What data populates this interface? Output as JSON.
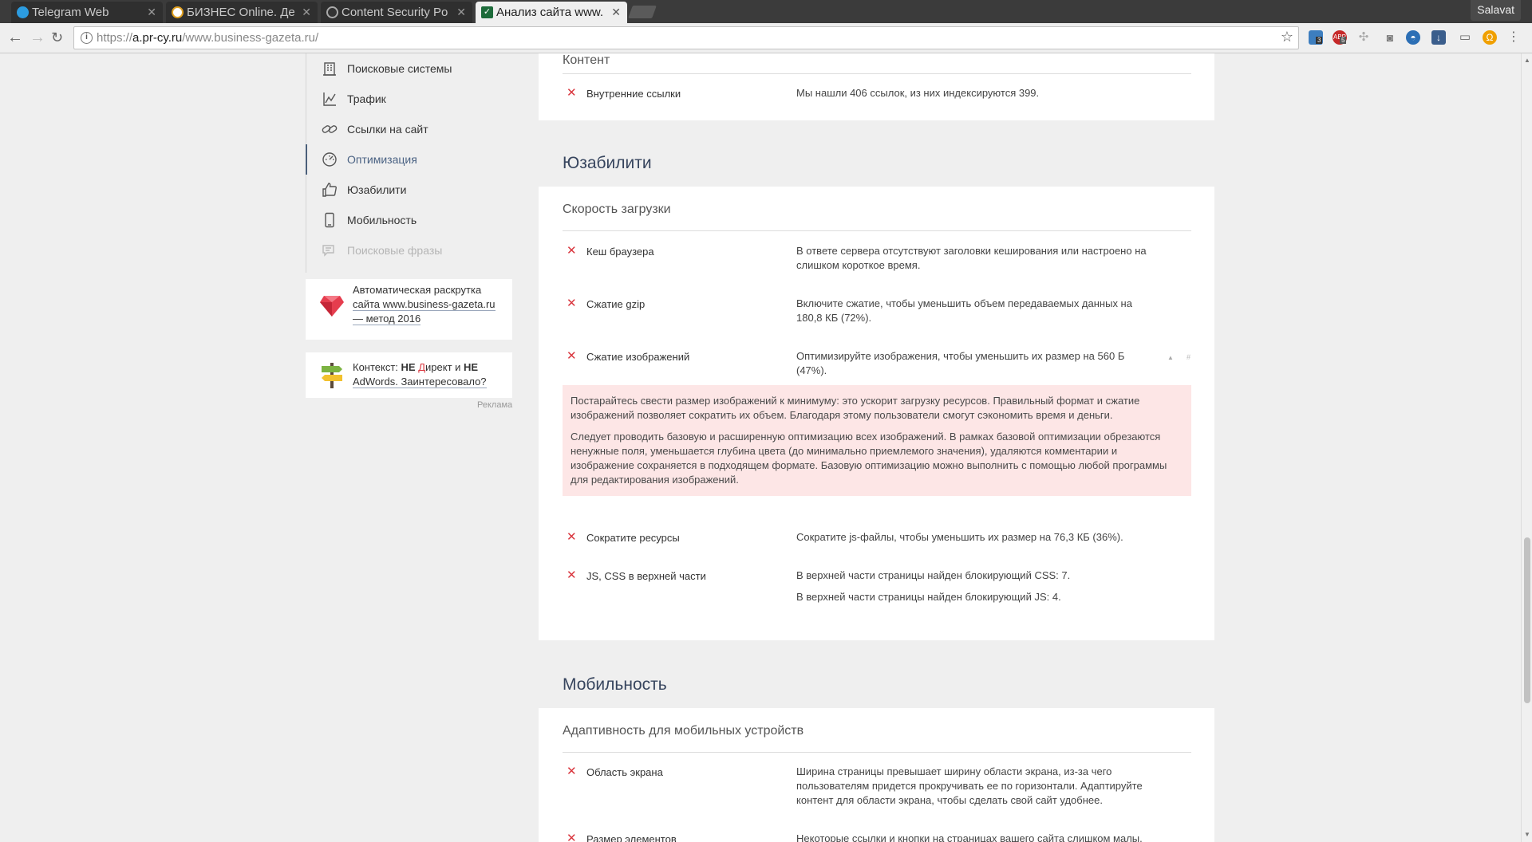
{
  "browser": {
    "tabs": [
      {
        "title": "Telegram Web",
        "active": false
      },
      {
        "title": "БИЗНЕС Online. Де",
        "active": false
      },
      {
        "title": "Content Security Po",
        "active": false
      },
      {
        "title": "Анализ сайта www.",
        "active": true
      }
    ],
    "profile": "Salavat",
    "url_prefix": "https://",
    "url_host": "a.pr-cy.ru",
    "url_path": "/www.business-gazeta.ru/",
    "ext_badges": [
      "3",
      "5"
    ]
  },
  "sidebar": {
    "items": [
      {
        "label": "Поисковые системы",
        "icon": "building-icon"
      },
      {
        "label": "Трафик",
        "icon": "chart-icon"
      },
      {
        "label": "Ссылки на сайт",
        "icon": "link-icon"
      },
      {
        "label": "Оптимизация",
        "icon": "speedometer-icon",
        "active": true
      },
      {
        "label": "Юзабилити",
        "icon": "thumbs-up-icon"
      },
      {
        "label": "Мобильность",
        "icon": "phone-icon"
      },
      {
        "label": "Поисковые фразы",
        "icon": "chat-icon",
        "disabled": true
      }
    ],
    "promo1": {
      "line1": "Автоматическая раскрутка",
      "line2": "сайта www.business-gazeta.ru",
      "line3": "— метод 2016"
    },
    "promo2": {
      "a": "Контекст: ",
      "b": "НЕ ",
      "c": "Д",
      "d": "ирект и ",
      "e": "НЕ",
      "f": "AdWords. Заинтересовало?"
    },
    "ad_label": "Реклама"
  },
  "content": {
    "content_section": {
      "title": "Контент",
      "rows": [
        {
          "name": "Внутренние ссылки",
          "desc": "Мы нашли 406 ссылок, из них индексируются 399."
        }
      ]
    },
    "usability": {
      "heading": "Юзабилити",
      "section_title": "Скорость загрузки",
      "rows": [
        {
          "name": "Кеш браузера",
          "desc": "В ответе сервера отсутствуют заголовки кеширования или настроено на слишком короткое время."
        },
        {
          "name": "Сжатие gzip",
          "desc": "Включите сжатие, чтобы уменьшить объем передаваемых данных на 180,8 КБ (72%)."
        },
        {
          "name": "Сжатие изображений",
          "desc": "Оптимизируйте изображения, чтобы уменьшить их размер на 560 Б (47%).",
          "hash": "#"
        },
        {
          "name": "Сократите ресурсы",
          "desc": "Сократите js-файлы, чтобы уменьшить их размер на 76,3 КБ (36%)."
        },
        {
          "name": "JS, CSS в верхней части",
          "desc": "В верхней части страницы найден блокирующий CSS: 7.",
          "desc2": "В верхней части страницы найден блокирующий JS: 4."
        }
      ],
      "hint_p1": "Постарайтесь свести размер изображений к минимуму: это ускорит загрузку ресурсов. Правильный формат и сжатие изображений позволяет сократить их объем. Благодаря этому пользователи смогут сэкономить время и деньги.",
      "hint_p2": "Следует проводить базовую и расширенную оптимизацию всех изображений. В рамках базовой оптимизации обрезаются ненужные поля, уменьшается глубина цвета (до минимально приемлемого значения), удаляются комментарии и изображение сохраняется в подходящем формате. Базовую оптимизацию можно выполнить с помощью любой программы для редактирования изображений."
    },
    "mobility": {
      "heading": "Мобильность",
      "section_title": "Адаптивность для мобильных устройств",
      "rows": [
        {
          "name": "Область экрана",
          "desc": "Ширина страницы превышает ширину области экрана, из-за чего пользователям придется прокручивать ее по горизонтали. Адаптируйте контент для области экрана, чтобы сделать свой сайт удобнее."
        },
        {
          "name": "Размер элементов",
          "desc": "Некоторые ссылки и кнопки на страницах вашего сайта слишком малы."
        }
      ]
    }
  },
  "colors": {
    "accent": "#4a6283",
    "error": "#d9363e",
    "hint_bg": "#fde6e6"
  }
}
